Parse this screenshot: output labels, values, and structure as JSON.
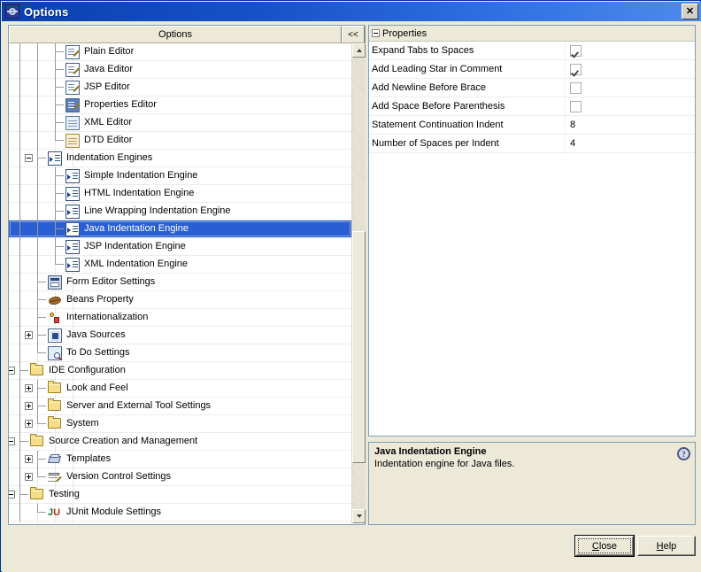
{
  "window": {
    "title": "Options",
    "icon": "options-gear-icon",
    "close_button": "✕"
  },
  "tree": {
    "header_label": "Options",
    "collapse_button": "<<",
    "scroll": {
      "up_arrow": "scroll-up-arrow",
      "down_arrow": "scroll-down-arrow"
    },
    "items": [
      {
        "label": "Plain Editor",
        "depth": 3,
        "icon": "editor-icon",
        "expander": "none",
        "selected": false
      },
      {
        "label": "Java Editor",
        "depth": 3,
        "icon": "editor-icon",
        "expander": "none",
        "selected": false
      },
      {
        "label": "JSP Editor",
        "depth": 3,
        "icon": "editor-icon",
        "expander": "none",
        "selected": false
      },
      {
        "label": "Properties Editor",
        "depth": 3,
        "icon": "properties-editor-icon",
        "expander": "none",
        "selected": false
      },
      {
        "label": "XML Editor",
        "depth": 3,
        "icon": "xml-editor-icon",
        "expander": "none",
        "selected": false
      },
      {
        "label": "DTD Editor",
        "depth": 3,
        "icon": "dtd-editor-icon",
        "expander": "none",
        "selected": false,
        "last": true
      },
      {
        "label": "Indentation Engines",
        "depth": 2,
        "icon": "indent-engine-icon",
        "expander": "minus",
        "selected": false
      },
      {
        "label": "Simple Indentation Engine",
        "depth": 3,
        "icon": "indent-engine-icon",
        "expander": "none",
        "selected": false
      },
      {
        "label": "HTML Indentation Engine",
        "depth": 3,
        "icon": "indent-engine-icon",
        "expander": "none",
        "selected": false
      },
      {
        "label": "Line Wrapping Indentation Engine",
        "depth": 3,
        "icon": "indent-engine-icon",
        "expander": "none",
        "selected": false
      },
      {
        "label": "Java Indentation Engine",
        "depth": 3,
        "icon": "indent-engine-icon",
        "expander": "none",
        "selected": true
      },
      {
        "label": "JSP Indentation Engine",
        "depth": 3,
        "icon": "indent-engine-icon",
        "expander": "none",
        "selected": false
      },
      {
        "label": "XML Indentation Engine",
        "depth": 3,
        "icon": "indent-engine-icon",
        "expander": "none",
        "selected": false,
        "last": true
      },
      {
        "label": "Form Editor Settings",
        "depth": 2,
        "icon": "form-editor-icon",
        "expander": "none",
        "selected": false
      },
      {
        "label": "Beans Property",
        "depth": 2,
        "icon": "beans-icon",
        "expander": "none",
        "selected": false
      },
      {
        "label": "Internationalization",
        "depth": 2,
        "icon": "i18n-icon",
        "expander": "none",
        "selected": false
      },
      {
        "label": "Java Sources",
        "depth": 2,
        "icon": "java-sources-icon",
        "expander": "plus",
        "selected": false
      },
      {
        "label": "To Do Settings",
        "depth": 2,
        "icon": "todo-icon",
        "expander": "none",
        "selected": false,
        "last": true
      },
      {
        "label": "IDE Configuration",
        "depth": 1,
        "icon": "folder-icon",
        "expander": "minus",
        "selected": false
      },
      {
        "label": "Look and Feel",
        "depth": 2,
        "icon": "folder-icon",
        "expander": "plus",
        "selected": false
      },
      {
        "label": "Server and External Tool Settings",
        "depth": 2,
        "icon": "folder-icon",
        "expander": "plus",
        "selected": false
      },
      {
        "label": "System",
        "depth": 2,
        "icon": "folder-icon",
        "expander": "plus",
        "selected": false,
        "last": true
      },
      {
        "label": "Source Creation and Management",
        "depth": 1,
        "icon": "folder-icon",
        "expander": "minus",
        "selected": false
      },
      {
        "label": "Templates",
        "depth": 2,
        "icon": "templates-icon",
        "expander": "plus",
        "selected": false
      },
      {
        "label": "Version Control Settings",
        "depth": 2,
        "icon": "version-control-icon",
        "expander": "plus",
        "selected": false,
        "last": true
      },
      {
        "label": "Testing",
        "depth": 1,
        "icon": "folder-icon",
        "expander": "minus",
        "selected": false
      },
      {
        "label": "JUnit Module Settings",
        "depth": 2,
        "icon": "junit-icon",
        "expander": "none",
        "selected": false,
        "last": true
      }
    ]
  },
  "properties": {
    "group_label": "Properties",
    "rows": [
      {
        "name": "Expand Tabs to Spaces",
        "type": "checkbox",
        "value": true
      },
      {
        "name": "Add Leading Star in Comment",
        "type": "checkbox",
        "value": true
      },
      {
        "name": "Add Newline Before Brace",
        "type": "checkbox",
        "value": false
      },
      {
        "name": "Add Space Before Parenthesis",
        "type": "checkbox",
        "value": false
      },
      {
        "name": "Statement Continuation Indent",
        "type": "text",
        "value": "8"
      },
      {
        "name": "Number of Spaces per Indent",
        "type": "text",
        "value": "4"
      }
    ]
  },
  "description": {
    "title": "Java Indentation Engine",
    "body": "Indentation engine for Java files.",
    "help_glyph": "?"
  },
  "footer": {
    "close": {
      "prefix": "",
      "mnemonic": "C",
      "suffix": "lose"
    },
    "help": {
      "prefix": "",
      "mnemonic": "H",
      "suffix": "elp"
    }
  },
  "colors": {
    "title_bar": "#0b3fae",
    "selection": "#2a5fd4",
    "dialog_face": "#ece9d8",
    "panel_border": "#7f9db9"
  }
}
